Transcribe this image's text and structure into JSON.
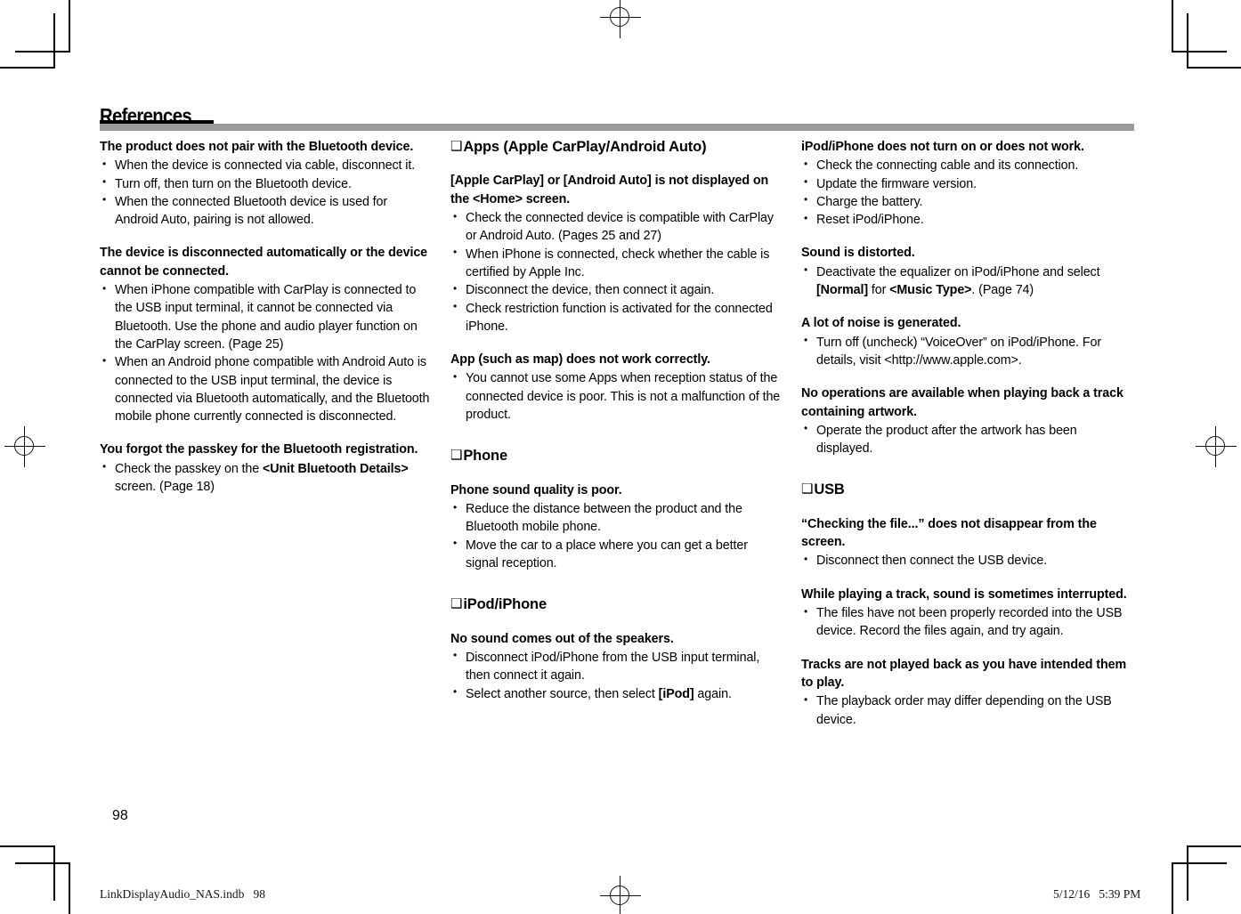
{
  "header": {
    "title": "References"
  },
  "footer": {
    "page_number": "98",
    "print_file": "LinkDisplayAudio_NAS.indb   98",
    "print_timestamp": "5/12/16   5:39 PM"
  },
  "icons": {
    "section_square": "❑"
  },
  "colors": {
    "heading_rule_gray": "#9a9a9a",
    "heading_rule_black": "#000000",
    "text": "#000000",
    "background": "#ffffff"
  },
  "columns": [
    {
      "blocks": [
        {
          "type": "question",
          "text": "The product does not pair with the Bluetooth device.",
          "items": [
            "When the device is connected via cable, disconnect it.",
            "Turn off, then turn on the Bluetooth device.",
            "When the connected Bluetooth device is used for Android Auto, pairing is not allowed."
          ]
        },
        {
          "type": "question",
          "text": "The device is disconnected automatically or the device cannot be connected.",
          "items": [
            "When iPhone compatible with CarPlay is connected to the USB input terminal, it cannot be connected via Bluetooth. Use the phone and audio player function on the CarPlay screen. (Page 25)",
            "When an Android phone compatible with Android Auto is connected to the USB input terminal, the device is connected via Bluetooth automatically, and the Bluetooth mobile phone currently connected is disconnected."
          ]
        },
        {
          "type": "question",
          "text": "You forgot the passkey for the Bluetooth registration.",
          "items_html": [
            "Check the passkey on the <b>&lt;Unit Bluetooth Details&gt;</b> screen. (Page 18)"
          ]
        }
      ]
    },
    {
      "blocks": [
        {
          "type": "section",
          "text": "Apps (Apple CarPlay/Android Auto)"
        },
        {
          "type": "question",
          "text": "[Apple CarPlay] or [Android Auto] is not displayed on the <Home> screen.",
          "items": [
            "Check the connected device is compatible with CarPlay or Android Auto. (Pages 25 and 27)",
            "When iPhone is connected, check whether the cable is certified by Apple Inc.",
            "Disconnect the device, then connect it again.",
            "Check restriction function is activated for the connected iPhone."
          ]
        },
        {
          "type": "question",
          "text": "App (such as map) does not work correctly.",
          "items": [
            "You cannot use some Apps when reception status of the connected device is poor. This is not a malfunction of the product."
          ]
        },
        {
          "type": "section",
          "text": "Phone"
        },
        {
          "type": "question",
          "text": "Phone sound quality is poor.",
          "items": [
            "Reduce the distance between the product and the Bluetooth mobile phone.",
            "Move the car to a place where you can get a better signal reception."
          ]
        },
        {
          "type": "section",
          "text": "iPod/iPhone"
        },
        {
          "type": "question",
          "text": "No sound comes out of the speakers.",
          "items_html": [
            "Disconnect iPod/iPhone from the USB input terminal, then connect it again.",
            "Select another source, then select <b>[iPod]</b> again."
          ]
        }
      ]
    },
    {
      "blocks": [
        {
          "type": "question",
          "text": "iPod/iPhone does not turn on or does not work.",
          "items": [
            "Check the connecting cable and its connection.",
            "Update the firmware version.",
            "Charge the battery.",
            "Reset iPod/iPhone."
          ]
        },
        {
          "type": "question",
          "text": "Sound is distorted.",
          "items_html": [
            "Deactivate the equalizer on iPod/iPhone and select <b>[Normal]</b> for <b>&lt;Music Type&gt;</b>. (Page 74)"
          ]
        },
        {
          "type": "question",
          "text": "A lot of noise is generated.",
          "items": [
            "Turn off (uncheck) “VoiceOver” on iPod/iPhone. For details, visit <http://www.apple.com>."
          ]
        },
        {
          "type": "question",
          "text": "No operations are available when playing back a track containing artwork.",
          "items": [
            "Operate the product after the artwork has been displayed."
          ]
        },
        {
          "type": "section",
          "text": "USB"
        },
        {
          "type": "question",
          "text": "“Checking the file...” does not disappear from the screen.",
          "items": [
            "Disconnect then connect the USB device."
          ]
        },
        {
          "type": "question",
          "text": "While playing a track, sound is sometimes interrupted.",
          "items": [
            "The files have not been properly recorded into the USB device. Record the files again, and try again."
          ]
        },
        {
          "type": "question",
          "text": "Tracks are not played back as you have intended them to play.",
          "items": [
            "The playback order may differ depending on the USB device."
          ]
        }
      ]
    }
  ]
}
